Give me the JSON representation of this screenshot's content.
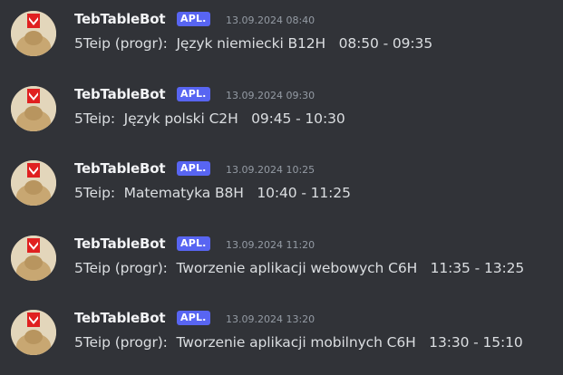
{
  "colors": {
    "background": "#313338",
    "author": "#f2f3f5",
    "badge": "#5865f2",
    "timestamp": "#949ba4",
    "text": "#dbdee1"
  },
  "messages": [
    {
      "author": "TebTableBot",
      "badge": "APL.",
      "timestamp": "13.09.2024 08:40",
      "content": "5Teip (progr):  Język niemiecki B12H   08:50 - 09:35",
      "avatar_icon": "bot-avatar-icon"
    },
    {
      "author": "TebTableBot",
      "badge": "APL.",
      "timestamp": "13.09.2024 09:30",
      "content": "5Teip:  Język polski C2H   09:45 - 10:30",
      "avatar_icon": "bot-avatar-icon"
    },
    {
      "author": "TebTableBot",
      "badge": "APL.",
      "timestamp": "13.09.2024 10:25",
      "content": "5Teip:  Matematyka B8H   10:40 - 11:25",
      "avatar_icon": "bot-avatar-icon"
    },
    {
      "author": "TebTableBot",
      "badge": "APL.",
      "timestamp": "13.09.2024 11:20",
      "content": "5Teip (progr):  Tworzenie aplikacji webowych C6H   11:35 - 13:25",
      "avatar_icon": "bot-avatar-icon"
    },
    {
      "author": "TebTableBot",
      "badge": "APL.",
      "timestamp": "13.09.2024 13:20",
      "content": "5Teip (progr):  Tworzenie aplikacji mobilnych C6H   13:30 - 15:10",
      "avatar_icon": "bot-avatar-icon"
    }
  ]
}
